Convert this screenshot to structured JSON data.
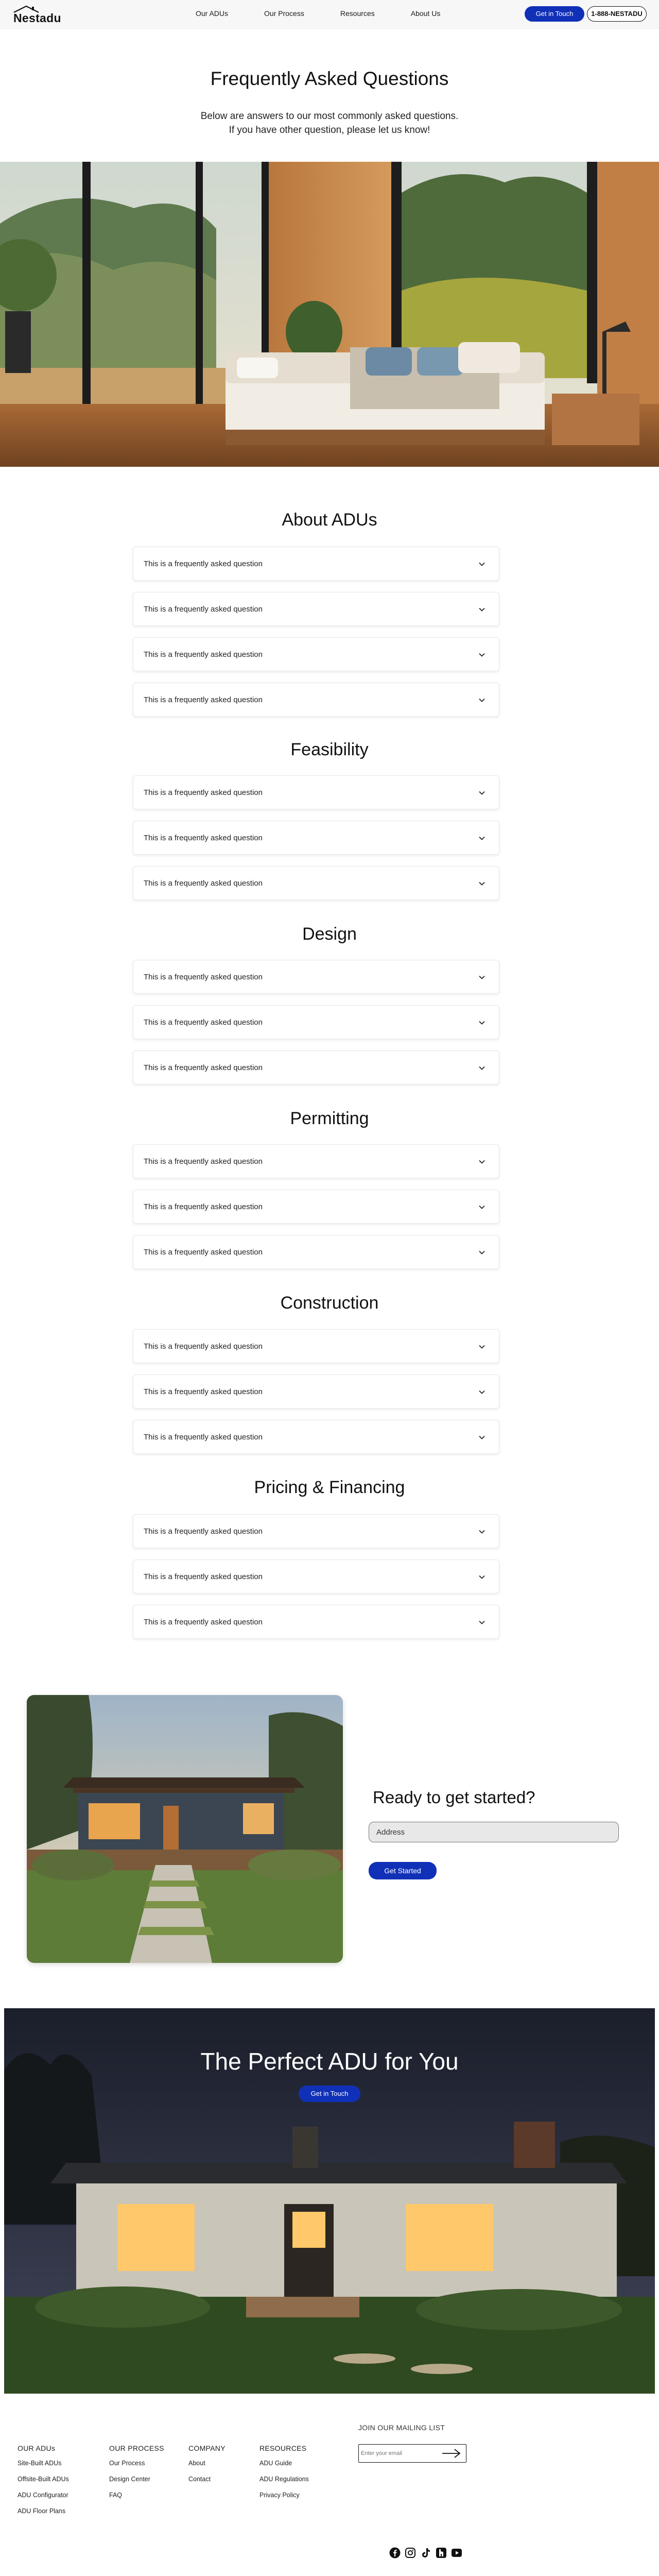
{
  "brand": {
    "name": "Nestadu"
  },
  "nav": {
    "links": [
      "Our ADUs",
      "Our Process",
      "Resources",
      "About Us"
    ],
    "cta": "Get in Touch",
    "phone": "1-888-NESTADU"
  },
  "hero": {
    "title": "Frequently Asked Questions",
    "subtitle_line1": "Below are answers to our most commonly asked questions.",
    "subtitle_line2": "If you have other question, please let us know!"
  },
  "faq": {
    "sections": [
      {
        "title": "About ADUs",
        "questions": [
          "This is a frequently asked question",
          "This is a frequently asked question",
          "This is a frequently asked question",
          "This is a frequently asked question"
        ]
      },
      {
        "title": "Feasibility",
        "questions": [
          "This is a frequently asked question",
          "This is a frequently asked question",
          "This is a frequently asked question"
        ]
      },
      {
        "title": "Design",
        "questions": [
          "This is a frequently asked question",
          "This is a frequently asked question",
          "This is a frequently asked question"
        ]
      },
      {
        "title": "Permitting",
        "questions": [
          "This is a frequently asked question",
          "This is a frequently asked question",
          "This is a frequently asked question"
        ]
      },
      {
        "title": "Construction",
        "questions": [
          "This is a frequently asked question",
          "This is a frequently asked question",
          "This is a frequently asked question"
        ]
      },
      {
        "title": "Pricing & Financing",
        "questions": [
          "This is a frequently asked question",
          "This is a frequently asked question",
          "This is a frequently asked question"
        ]
      }
    ]
  },
  "ready": {
    "title": "Ready to get started?",
    "address_placeholder": "Address",
    "button": "Get Started"
  },
  "perfect": {
    "title": "The Perfect ADU for You",
    "button": "Get in Touch"
  },
  "footer": {
    "columns": [
      {
        "heading": "OUR ADUs",
        "links": [
          "Site-Built ADUs",
          "Offsite-Built ADUs",
          "ADU Configurator",
          "ADU Floor Plans"
        ]
      },
      {
        "heading": "OUR PROCESS",
        "links": [
          "Our Process",
          "Design Center",
          "FAQ"
        ]
      },
      {
        "heading": "COMPANY",
        "links": [
          "About",
          "Contact"
        ]
      },
      {
        "heading": "RESOURCES",
        "links": [
          "ADU Guide",
          "ADU Regulations",
          "Privacy Policy"
        ]
      }
    ],
    "mailing_label": "JOIN OUR MAILING LIST",
    "email_placeholder": "Enter your email",
    "social_icons": [
      "facebook-icon",
      "instagram-icon",
      "tiktok-icon",
      "houzz-icon",
      "youtube-icon"
    ]
  },
  "colors": {
    "accent": "#1030b8",
    "text": "#111111",
    "background": "#ffffff"
  }
}
